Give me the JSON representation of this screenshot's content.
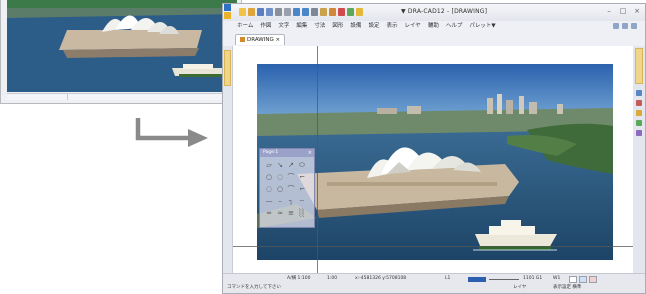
{
  "app": {
    "title": "▼  DRA-CAD12 - [DRAWING]",
    "menu": [
      "ホーム",
      "作図",
      "文字",
      "編集",
      "寸法",
      "図形",
      "設備",
      "設定",
      "表示",
      "レイヤ",
      "輔助",
      "ヘルプ",
      "パレット▼"
    ],
    "doc_tab": "DRAWING ×",
    "window_controls": {
      "minimize": "–",
      "restore": "□",
      "close": "×"
    }
  },
  "palette": {
    "title": "Page:1",
    "close": "×",
    "icons": [
      "▱",
      "↘",
      "↗",
      "⬭",
      "○",
      "◌",
      "⌒",
      "⌐",
      "◌",
      "○",
      "⌒",
      "⌐",
      "—",
      "–",
      "┐",
      "┄",
      "═",
      "≈",
      "≡",
      "░"
    ]
  },
  "status": {
    "scale": "A/横  1:100",
    "scale2": "1:00",
    "coords": "x:-4581326  y:5708108",
    "layer_no": "L1",
    "value1": "1101  G1",
    "value2": "W1",
    "prompt": "コマンドを入力して下さい",
    "mode": "レイヤ",
    "mode2": "表示設定  横準"
  },
  "colors": {
    "sky": "#2f6fb7",
    "water": "#2b5f8c",
    "accent": "#2d5fb0",
    "palette_border": "#7f86b0"
  }
}
